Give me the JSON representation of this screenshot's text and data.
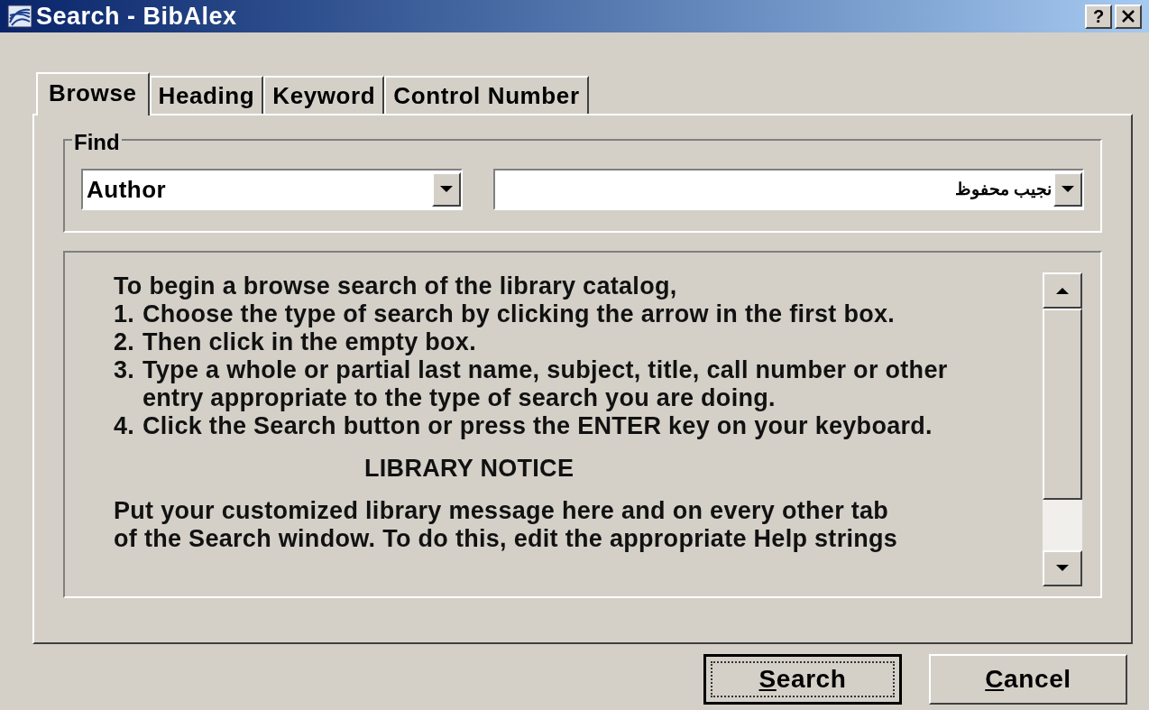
{
  "window": {
    "title": "Search - BibAlex",
    "help_button": "?"
  },
  "tabs": [
    {
      "label": "Browse",
      "selected": true
    },
    {
      "label": "Heading",
      "selected": false
    },
    {
      "label": "Keyword",
      "selected": false
    },
    {
      "label": "Control Number",
      "selected": false
    }
  ],
  "find": {
    "label": "Find",
    "search_type": "Author",
    "search_term": "نجيب محفوظ"
  },
  "help_text": {
    "intro": "To begin a browse search of the library catalog,",
    "steps": [
      {
        "number": "1.",
        "text": "Choose the type of search by clicking the arrow in the first box."
      },
      {
        "number": "2.",
        "text": "Then click in the empty box."
      },
      {
        "number": "3.",
        "text": "Type a whole or partial last name, subject, title, call number or other entry appropriate to the type of search you are doing."
      },
      {
        "number": "4.",
        "text": "Click the Search button or press the ENTER key on your keyboard."
      }
    ],
    "notice_heading": "LIBRARY NOTICE",
    "notice_lines": [
      "Put your customized library message here and on every other tab",
      "of the Search window. To do this, edit the appropriate Help strings"
    ]
  },
  "buttons": [
    {
      "label": "Search",
      "default": true
    },
    {
      "label": "Cancel",
      "default": false
    }
  ]
}
